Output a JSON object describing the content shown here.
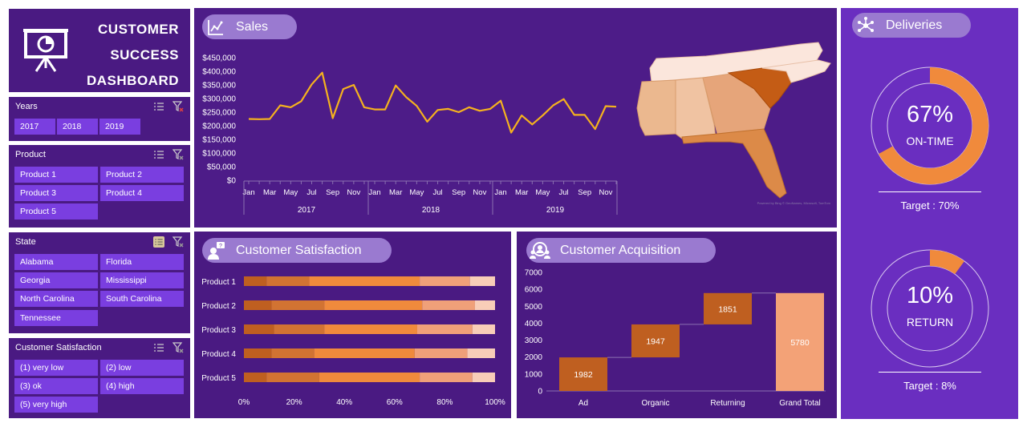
{
  "title": {
    "line1": "CUSTOMER",
    "line2": "SUCCESS",
    "line3": "DASHBOARD"
  },
  "slicers": {
    "years": {
      "title": "Years",
      "items": [
        "2017",
        "2018",
        "2019"
      ]
    },
    "product": {
      "title": "Product",
      "items": [
        "Product 1",
        "Product 2",
        "Product 3",
        "Product 4",
        "Product 5"
      ]
    },
    "state": {
      "title": "State",
      "items": [
        "Alabama",
        "Florida",
        "Georgia",
        "Mississippi",
        "North Carolina",
        "South Carolina",
        "Tennessee"
      ]
    },
    "satisfaction": {
      "title": "Customer Satisfaction",
      "items": [
        "(1) very low",
        "(2) low",
        "(3) ok",
        "(4) high",
        "(5) very high"
      ]
    }
  },
  "sections": {
    "sales": "Sales",
    "satisfaction": "Customer Satisfaction",
    "acquisition": "Customer Acquisition",
    "deliveries": "Deliveries"
  },
  "deliveries": {
    "ontime": {
      "value": "67%",
      "label": "ON-TIME",
      "target": "Target : 70%",
      "fraction": 0.67
    },
    "return": {
      "value": "10%",
      "label": "RETURN",
      "target": "Target : 8%",
      "fraction": 0.1
    }
  },
  "map_attribution": "Powered by Bing © GeoNames, Microsoft, TomTom",
  "colors": {
    "line": "#f5b21e",
    "donut": "#f08a3c",
    "darkBrown": "#bf5f20",
    "orange": "#f08a3c",
    "salmon": "#f0a079",
    "pale": "#f8cdb8",
    "peach": "#f3a277"
  },
  "chart_data": [
    {
      "type": "line",
      "title": "Sales",
      "ylabels": [
        "$450,000",
        "$400,000",
        "$350,000",
        "$300,000",
        "$250,000",
        "$200,000",
        "$150,000",
        "$100,000",
        "$50,000",
        "$0"
      ],
      "ylim": [
        0,
        450000
      ],
      "month_labels": [
        "Jan",
        "Mar",
        "May",
        "Jul",
        "Sep",
        "Nov",
        "Jan",
        "Mar",
        "May",
        "Jul",
        "Sep",
        "Nov",
        "Jan",
        "Mar",
        "May",
        "Jul",
        "Sep",
        "Nov"
      ],
      "year_labels": [
        "2017",
        "2018",
        "2019"
      ],
      "values": [
        225000,
        224000,
        225000,
        275000,
        268000,
        290000,
        352000,
        395000,
        228000,
        335000,
        350000,
        268000,
        260000,
        260000,
        348000,
        305000,
        273000,
        215000,
        258000,
        262000,
        250000,
        268000,
        255000,
        262000,
        292000,
        175000,
        238000,
        205000,
        238000,
        275000,
        298000,
        240000,
        240000,
        188000,
        272000,
        270000
      ]
    },
    {
      "type": "bar",
      "title": "Customer Satisfaction",
      "stacked": "100%",
      "categories": [
        "Product 1",
        "Product 2",
        "Product 3",
        "Product 4",
        "Product 5"
      ],
      "xlabels": [
        "0%",
        "20%",
        "40%",
        "60%",
        "80%",
        "100%"
      ],
      "series": [
        {
          "values": [
            9,
            11,
            12,
            11,
            9
          ]
        },
        {
          "values": [
            17,
            21,
            20,
            17,
            21
          ]
        },
        {
          "values": [
            44,
            39,
            37,
            40,
            40
          ]
        },
        {
          "values": [
            20,
            21,
            22,
            21,
            21
          ]
        },
        {
          "values": [
            10,
            8,
            9,
            11,
            9
          ]
        }
      ]
    },
    {
      "type": "bar",
      "title": "Customer Acquisition",
      "waterfall": true,
      "categories": [
        "Ad",
        "Organic",
        "Returning",
        "Grand Total"
      ],
      "values": [
        1982,
        1947,
        1851,
        5780
      ],
      "ylabels": [
        "7000",
        "6000",
        "5000",
        "4000",
        "3000",
        "2000",
        "1000",
        "0"
      ],
      "ylim": [
        0,
        7000
      ]
    }
  ]
}
